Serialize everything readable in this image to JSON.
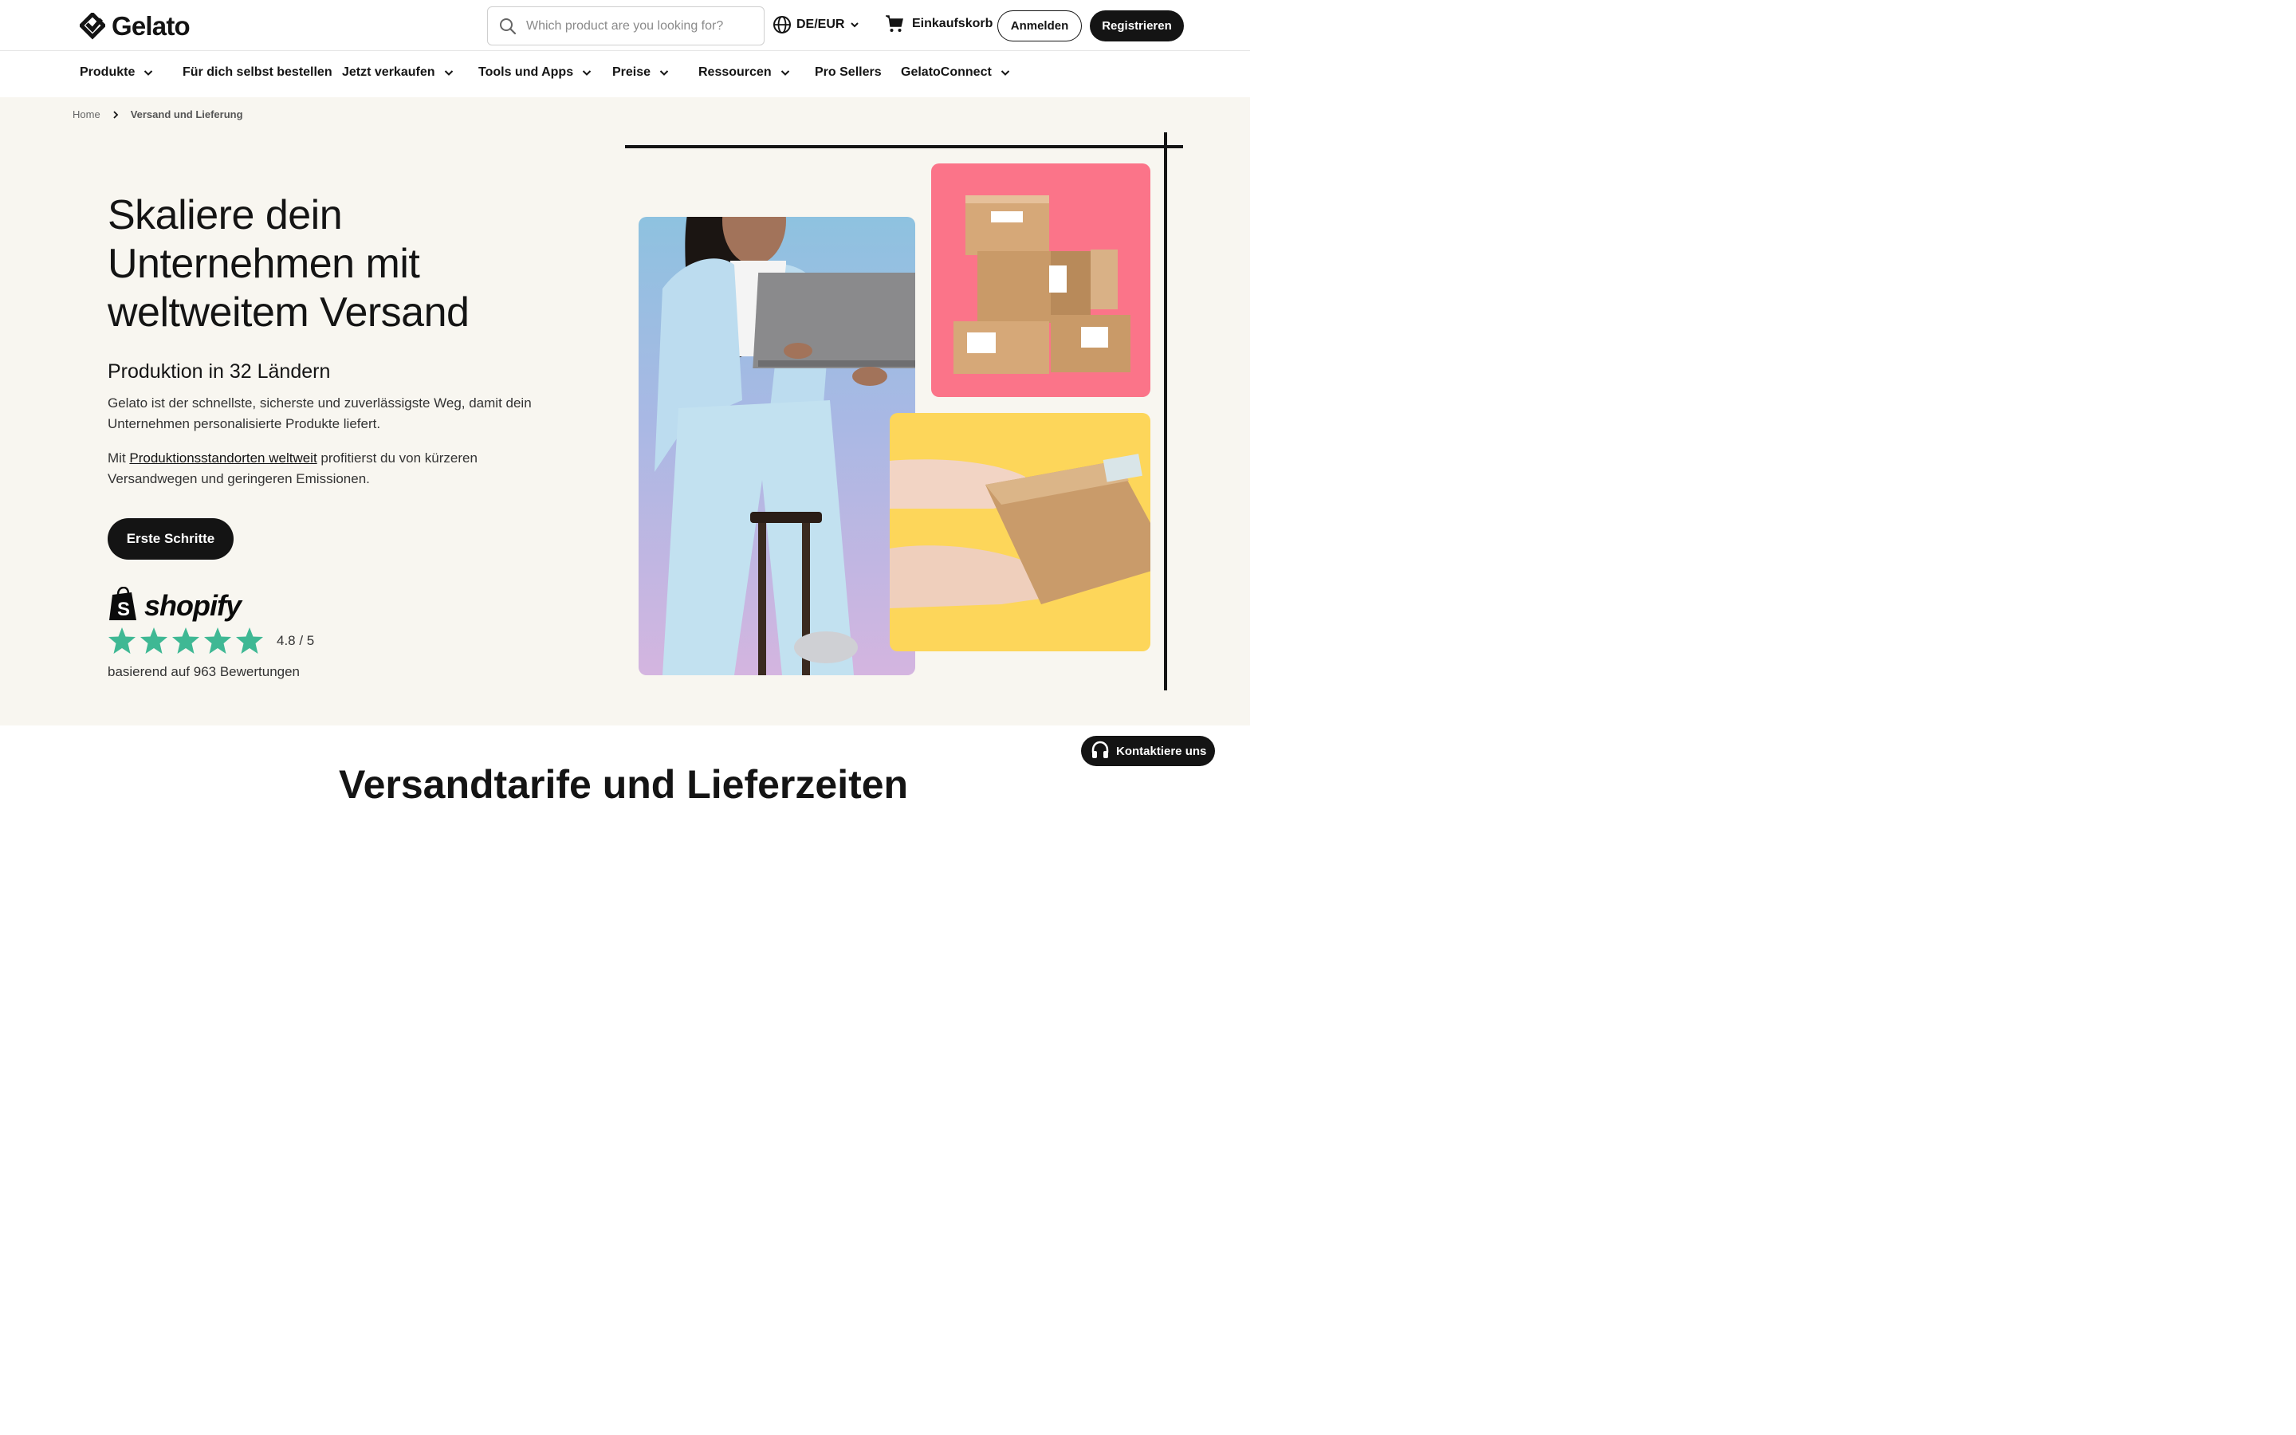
{
  "header": {
    "brand": "Gelato",
    "search_placeholder": "Which product are you looking for?",
    "locale": "DE/EUR",
    "cart_label": "Einkaufskorb",
    "login_label": "Anmelden",
    "register_label": "Registrieren"
  },
  "nav": [
    {
      "label": "Produkte",
      "dropdown": true
    },
    {
      "label": "Für dich selbst bestellen",
      "dropdown": false
    },
    {
      "label": "Jetzt verkaufen",
      "dropdown": true
    },
    {
      "label": "Tools und Apps",
      "dropdown": true
    },
    {
      "label": "Preise",
      "dropdown": true
    },
    {
      "label": "Ressourcen",
      "dropdown": true
    },
    {
      "label": "Pro Sellers",
      "dropdown": false
    },
    {
      "label": "GelatoConnect",
      "dropdown": true
    }
  ],
  "breadcrumb": {
    "home": "Home",
    "current": "Versand und Lieferung"
  },
  "hero": {
    "title_line1": "Skaliere dein",
    "title_line2": "Unternehmen mit",
    "title_line3": "weltweitem Versand",
    "subtitle": "Produktion in 32 Ländern",
    "paragraph1": "Gelato ist der schnellste, sicherste und zuverlässigste Weg, damit dein Unternehmen personalisierte Produkte liefert.",
    "paragraph2_prefix": "Mit ",
    "paragraph2_link": "Produktionsstandorten weltweit",
    "paragraph2_suffix": " profitierst du von kürzeren Versandwegen und geringeren Emissionen.",
    "cta_label": "Erste Schritte"
  },
  "review": {
    "platform": "shopify",
    "stars": 5,
    "rating_text": "4.8 / 5",
    "reviews_text": "basierend auf 963 Bewertungen",
    "star_color": "#3fb894"
  },
  "lower": {
    "section_title": "Versandtarife und Lieferzeiten"
  },
  "contact_label": "Kontaktiere uns",
  "colors": {
    "hero_bg": "#f8f6f0",
    "dark": "#141414",
    "pink_panel": "#fb7489",
    "yellow_panel": "#fdd65a",
    "blue_panel": "#8ec2e0"
  }
}
